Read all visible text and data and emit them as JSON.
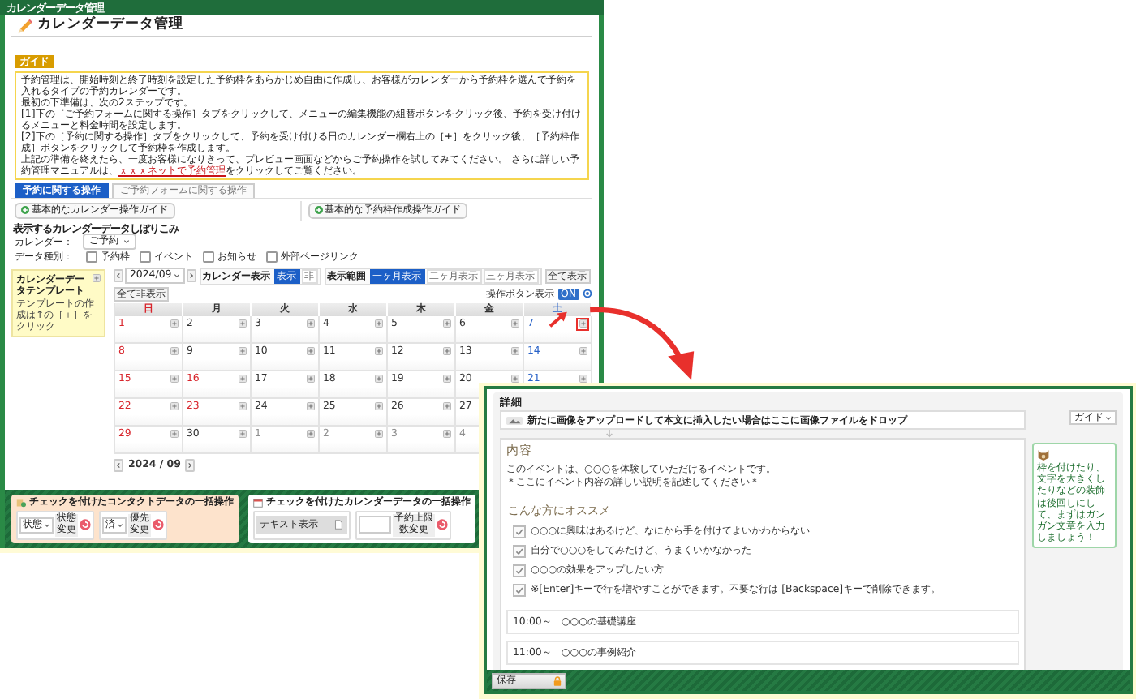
{
  "main_window": {
    "title_bar": "カレンダーデータ管理",
    "heading": "カレンダーデータ管理",
    "guide": {
      "tag": "ガイド",
      "lines": [
        "予約管理は、開始時刻と終了時刻を設定した予約枠をあらかじめ自由に作成し、お客様がカレンダーから予約枠を選んで予約を入れるタイプの予約カレンダーです。",
        "最初の下準備は、次の2ステップです。",
        "[1]下の［ご予約フォームに関する操作］タブをクリックして、メニューの編集機能の組替ボタンをクリック後、予約を受け付けるメニューと料金時間を設定します。",
        "[2]下の［予約に関する操作］タブをクリックして、予約を受け付ける日のカレンダー欄右上の［+］をクリック後、［予約枠作成］ボタンをクリックして予約枠を作成します。"
      ],
      "last_line": {
        "before": "上記の準備を終えたら、一度お客様になりきって、プレビュー画面などからご予約操作を試してみてください。 さらに詳しい予約管理マニュアルは、",
        "link": "ｘｘｘネットで予約管理",
        "after": "をクリックしてご覧ください。"
      }
    },
    "tabs": [
      {
        "label": "予約に関する操作",
        "selected": true
      },
      {
        "label": "ご予約フォームに関する操作",
        "selected": false
      }
    ],
    "guide_buttons": [
      "基本的なカレンダー操作ガイド",
      "基本的な予約枠作成操作ガイド"
    ],
    "filter": {
      "title": "表示するカレンダーデータしぼりこみ",
      "calendar_label": "カレンダー：",
      "calendar_value": "ご予約",
      "type_label": "データ種別：",
      "types": [
        {
          "label": "予約枠",
          "checked": false
        },
        {
          "label": "イベント",
          "checked": false
        },
        {
          "label": "お知らせ",
          "checked": false
        },
        {
          "label": "外部ページリンク",
          "checked": false
        }
      ]
    },
    "template_panel": {
      "title": "カレンダーデータテンプレート",
      "hint": "テンプレートの作成は↑の［＋］をクリック"
    },
    "toolbar": {
      "month": "2024/09",
      "display_label": "カレンダー表示",
      "display_options": [
        {
          "label": "表示",
          "selected": true
        },
        {
          "label": "非",
          "selected": false
        }
      ],
      "range_label": "表示範囲",
      "range_options": [
        {
          "label": "一ヶ月表示",
          "selected": true
        },
        {
          "label": "二ヶ月表示",
          "selected": false
        },
        {
          "label": "三ヶ月表示",
          "selected": false
        }
      ],
      "actions": [
        "全て表示",
        "全て非表示"
      ],
      "buttons_label": "操作ボタン表示",
      "buttons_toggle": {
        "label": "ON",
        "on": true
      }
    },
    "calendar": {
      "weekdays": [
        {
          "label": "日",
          "kind": "sun"
        },
        {
          "label": "月",
          "kind": "weekday"
        },
        {
          "label": "火",
          "kind": "weekday"
        },
        {
          "label": "水",
          "kind": "weekday"
        },
        {
          "label": "木",
          "kind": "weekday"
        },
        {
          "label": "金",
          "kind": "weekday"
        },
        {
          "label": "土",
          "kind": "sat"
        }
      ],
      "weeks": [
        [
          {
            "day": "1",
            "kind": "sun",
            "marked": false
          },
          {
            "day": "2",
            "kind": "weekday",
            "marked": false
          },
          {
            "day": "3",
            "kind": "weekday",
            "marked": false
          },
          {
            "day": "4",
            "kind": "weekday",
            "marked": false
          },
          {
            "day": "5",
            "kind": "weekday",
            "marked": false
          },
          {
            "day": "6",
            "kind": "weekday",
            "marked": false
          },
          {
            "day": "7",
            "kind": "sat",
            "marked": true
          }
        ],
        [
          {
            "day": "8",
            "kind": "sun",
            "marked": false
          },
          {
            "day": "9",
            "kind": "weekday",
            "marked": false
          },
          {
            "day": "10",
            "kind": "weekday",
            "marked": false
          },
          {
            "day": "11",
            "kind": "weekday",
            "marked": false
          },
          {
            "day": "12",
            "kind": "weekday",
            "marked": false
          },
          {
            "day": "13",
            "kind": "weekday",
            "marked": false
          },
          {
            "day": "14",
            "kind": "sat",
            "marked": false
          }
        ],
        [
          {
            "day": "15",
            "kind": "sun",
            "marked": false
          },
          {
            "day": "16",
            "kind": "holiday",
            "marked": false
          },
          {
            "day": "17",
            "kind": "weekday",
            "marked": false
          },
          {
            "day": "18",
            "kind": "weekday",
            "marked": false
          },
          {
            "day": "19",
            "kind": "weekday",
            "marked": false
          },
          {
            "day": "20",
            "kind": "weekday",
            "marked": false
          },
          {
            "day": "21",
            "kind": "sat",
            "marked": false
          }
        ],
        [
          {
            "day": "22",
            "kind": "sun",
            "marked": false
          },
          {
            "day": "23",
            "kind": "holiday",
            "marked": false
          },
          {
            "day": "24",
            "kind": "weekday",
            "marked": false
          },
          {
            "day": "25",
            "kind": "weekday",
            "marked": false
          },
          {
            "day": "26",
            "kind": "weekday",
            "marked": false
          },
          {
            "day": "27",
            "kind": "weekday",
            "marked": false
          }
        ],
        [
          {
            "day": "29",
            "kind": "sun",
            "marked": false
          },
          {
            "day": "30",
            "kind": "weekday",
            "marked": false
          },
          {
            "day": "1",
            "kind": "other",
            "marked": false
          },
          {
            "day": "2",
            "kind": "other",
            "marked": false
          },
          {
            "day": "3",
            "kind": "other",
            "marked": false
          },
          {
            "day": "4",
            "kind": "other",
            "marked": false
          }
        ]
      ]
    },
    "pager": "2024 / 09",
    "bulk_actions": [
      {
        "kind": "contact",
        "title": "チェックを付けたコンタクトデータの一括操作",
        "controls": [
          {
            "kind": "select",
            "value": "状態",
            "action": "状態変更"
          },
          {
            "kind": "select",
            "value": "済",
            "action": "優先変更"
          }
        ]
      },
      {
        "kind": "calendar",
        "title": "チェックを付けたカレンダーデータの一括操作",
        "controls": [
          {
            "kind": "field",
            "value": "テキスト表示"
          },
          {
            "kind": "input",
            "action": "予約上限数変更"
          }
        ]
      }
    ]
  },
  "detail_window": {
    "title": "詳細",
    "drop_hint": "新たに画像をアップロードして本文に挿入したい場合はここに画像ファイルをドロップ",
    "guide_button": "ガイド",
    "editor": {
      "heading": "内容",
      "paragraphs": [
        "このイベントは、○○○を体験していただけるイベントです。",
        "＊ここにイベント内容の詳しい説明を記述してください＊"
      ],
      "subheading": "こんな方にオススメ",
      "checklist": [
        {
          "text": "○○○に興味はあるけど、なにから手を付けてよいかわからない",
          "checked": true
        },
        {
          "text": "自分で○○○をしてみたけど、うまくいかなかった",
          "checked": true
        },
        {
          "text": "○○○の効果をアップしたい方",
          "checked": true
        },
        {
          "text": "※[Enter]キーで行を増やすことができます。不要な行は [Backspace]キーで削除できます。",
          "checked": true
        }
      ],
      "schedule": [
        {
          "time": "10:00～",
          "title": "○○○の基礎講座"
        },
        {
          "time": "11:00～",
          "title": "○○○の事例紹介"
        }
      ]
    },
    "tip": "枠を付けたり、文字を大きくしたりなどの装飾は後回しにして、まずはガンガン文章を入力しましょう！",
    "save_button": "保存"
  }
}
